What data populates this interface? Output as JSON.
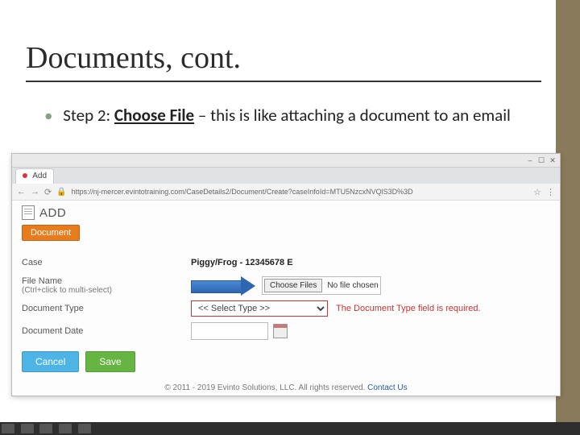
{
  "slide": {
    "title": "Documents, cont.",
    "bullet_dot": "•",
    "step_prefix": "Step 2: ",
    "step_action": "Choose File",
    "step_suffix": " – this is like attaching a document to an email"
  },
  "browser": {
    "tab_title": "Add",
    "url": "https://nj-mercer.evintotraining.com/CaseDetails2/Document/Create?caseInfoId=MTU5NzcxNVQlS3D%3D",
    "win_min": "–",
    "win_max": "☐",
    "win_close": "✕",
    "nav_back": "←",
    "nav_fwd": "→",
    "nav_reload": "⟳",
    "star": "☆",
    "menu": "⋮"
  },
  "form": {
    "header": "ADD",
    "tab_label": "Document",
    "rows": {
      "case_label": "Case",
      "case_value": "Piggy/Frog - 12345678 E",
      "file_label": "File Name",
      "file_hint": "(Ctrl+click to multi-select)",
      "choose_btn": "Choose Files",
      "no_file": "No file chosen",
      "type_label": "Document Type",
      "type_placeholder": "<< Select Type >>",
      "type_error": "The Document Type field is required.",
      "date_label": "Document Date"
    },
    "buttons": {
      "cancel": "Cancel",
      "save": "Save"
    },
    "footer_copyright": "© 2011 - 2019 Evinto Solutions, LLC. All rights reserved.",
    "footer_contact": "Contact Us"
  },
  "colors": {
    "accent_side": "#8a7a5c",
    "doc_tab": "#e87b1c",
    "arrow": "#2f66b0",
    "error": "#c33",
    "cancel_btn": "#4db5e5",
    "save_btn": "#66b543"
  }
}
